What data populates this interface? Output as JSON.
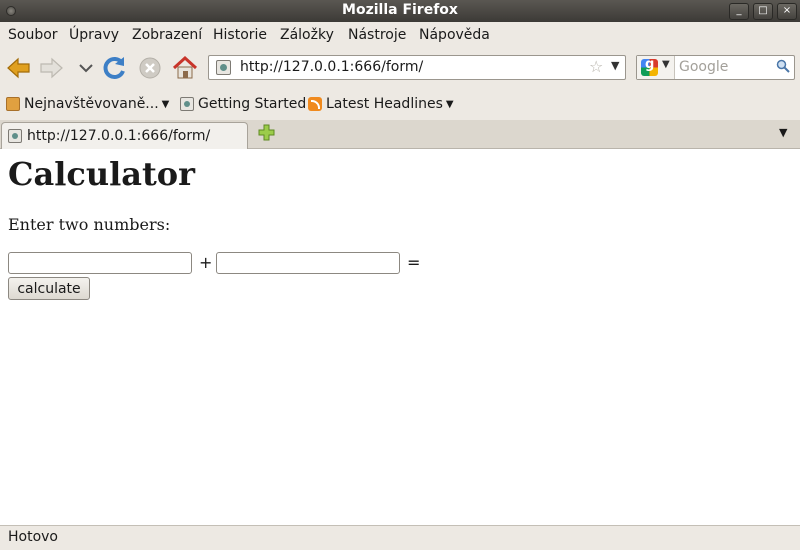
{
  "window": {
    "title": "Mozilla Firefox"
  },
  "menu": [
    "Soubor",
    "Úpravy",
    "Zobrazení",
    "Historie",
    "Záložky",
    "Nástroje",
    "Nápověda"
  ],
  "navbar": {
    "url": "http://127.0.0.1:666/form/",
    "search_placeholder": "Google"
  },
  "bookmarks": {
    "most_visited": "Nejnavštěvovaně...",
    "getting_started": "Getting Started",
    "latest_headlines": "Latest Headlines"
  },
  "tab": {
    "label": "http://127.0.0.1:666/form/"
  },
  "page": {
    "heading": "Calculator",
    "instruction": "Enter two numbers:",
    "plus": "+",
    "equals": "=",
    "first_value": "",
    "second_value": "",
    "button_label": "calculate"
  },
  "status": {
    "text": "Hotovo"
  },
  "icons": [
    "back-arrow-icon",
    "forward-arrow-icon",
    "history-dropdown-icon",
    "reload-icon",
    "stop-icon",
    "home-icon",
    "star-icon",
    "search-icon",
    "new-tab-icon"
  ]
}
